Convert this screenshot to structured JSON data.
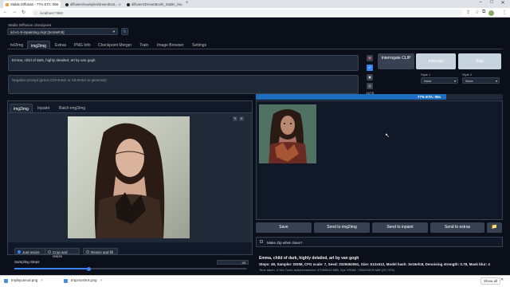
{
  "browser": {
    "tabs": [
      {
        "label": "Stable Diffusion - 77% ETA: 00s",
        "active": true
      },
      {
        "label": "diffusers/examples/dreamboot...",
        "active": false
      },
      {
        "label": "diffusers/DreamBooth_Stable_Di...",
        "active": false
      }
    ],
    "new_tab": "+",
    "url": "localhost:7860",
    "window_controls": [
      "–",
      "□",
      "✕"
    ]
  },
  "app": {
    "checkpoint_label": "Stable Diffusion checkpoint",
    "checkpoint_value": "sd-v1-5-inpainting.ckpt [3e16efc8]",
    "refresh_icon": "↻",
    "tabs": [
      "txt2img",
      "img2img",
      "Extras",
      "PNG Info",
      "Checkpoint Merger",
      "Train",
      "Image Browser",
      "Settings"
    ],
    "active_tab": "img2img",
    "prompt": "Emma, child of dark, highly detailed, art by van gogh",
    "negative_prompt_placeholder": "Negative prompt (press Ctrl+Enter or Alt+Enter to generate)",
    "token_count": "13/75",
    "interrogate_clip": "Interrogate CLIP",
    "interrogate_deepbooru": "Interrupt",
    "skip": "Skip",
    "style1_label": "Style 1",
    "style1_value": "None",
    "style2_label": "Style 2",
    "style2_value": "None",
    "progress_percent": 77,
    "progress_text": "77% ETA: 00s",
    "input_tabs": [
      "img2img",
      "Inpaint",
      "Batch img2img"
    ],
    "active_input_tab": "img2img",
    "resize_modes": [
      "Just resize",
      "Crop and resize",
      "Resize and fill"
    ],
    "resize_selected": "Just resize",
    "sampling_steps_label": "Sampling Steps",
    "sampling_steps_value": "49",
    "sampling_steps_fraction": 0.32,
    "output_buttons": [
      "Save",
      "Send to img2img",
      "Send to inpaint",
      "Send to extras"
    ],
    "folder_icon": "📁",
    "make_zip_label": "Make Zip when Save?",
    "gen_info_title": "Emma, child of dark, highly detailed, art by van gogh",
    "gen_info_params": "Steps: 49, Sampler: DDIM, CFG scale: 7, Seed: 3329452061, Size: 512x512, Model hash: 3e16efc8, Denoising strength: 0.78, Mask blur: 4",
    "time_info": "Time taken: 2.94s  Torch active/reserved: 4705/5242 MiB, Sys VRAM: 7306/24576 MiB (29.73%)"
  },
  "downloads": {
    "items": [
      "tmpbyusnod.png",
      "tmpzsos0ck.png"
    ],
    "show_all": "Show all",
    "close": "✕"
  },
  "colors": {
    "accent": "#3b82f6",
    "progress": "#1f6fc1",
    "bg": "#0b0f19",
    "panel": "#1f2937"
  }
}
